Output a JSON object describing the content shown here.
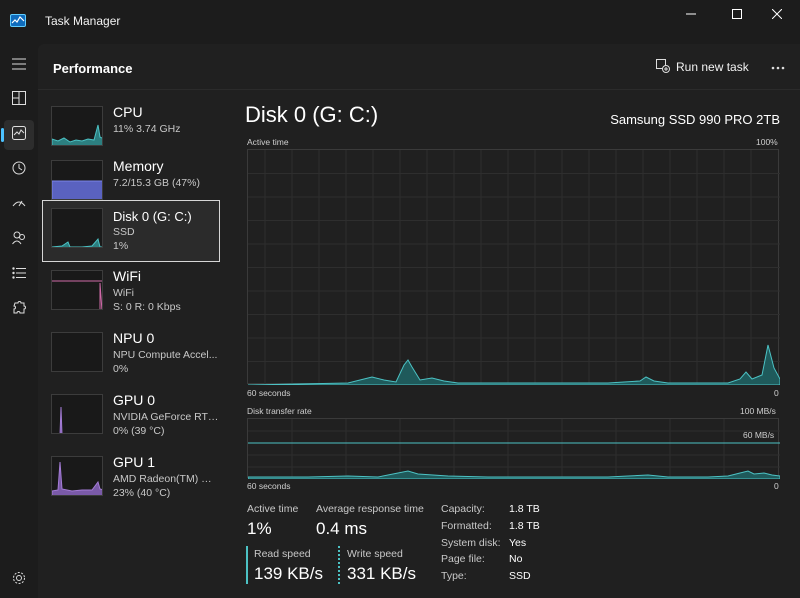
{
  "window": {
    "title": "Task Manager",
    "icon": "task-manager-icon",
    "controls": [
      "minimize-icon",
      "maximize-icon",
      "close-icon"
    ]
  },
  "rail": {
    "items": [
      {
        "name": "hamburger-menu-icon"
      },
      {
        "name": "processes-icon"
      },
      {
        "name": "performance-icon",
        "active": true
      },
      {
        "name": "app-history-icon"
      },
      {
        "name": "startup-apps-icon"
      },
      {
        "name": "users-icon"
      },
      {
        "name": "details-icon"
      },
      {
        "name": "services-icon"
      },
      {
        "name": "settings-icon"
      }
    ]
  },
  "header": {
    "title": "Performance",
    "run_new_task": "Run new task",
    "more": "more-options-icon"
  },
  "devices": [
    {
      "name": "CPU",
      "line1": "11%  3.74 GHz",
      "line2": "",
      "color": "#4cc2c4"
    },
    {
      "name": "Memory",
      "line1": "7.2/15.3 GB (47%)",
      "line2": "",
      "color": "#7b84e6"
    },
    {
      "name": "Disk 0 (G: C:)",
      "line1": "SSD",
      "line2": "1%",
      "color": "#4cc2c4",
      "selected": true
    },
    {
      "name": "WiFi",
      "line1": "WiFi",
      "line2": "S: 0  R: 0 Kbps",
      "color": "#d06aa8"
    },
    {
      "name": "NPU 0",
      "line1": "NPU Compute Accel...",
      "line2": "0%",
      "color": "#4cc2c4"
    },
    {
      "name": "GPU 0",
      "line1": "NVIDIA GeForce RTX...",
      "line2": "0%  (39 °C)",
      "color": "#a47cd6"
    },
    {
      "name": "GPU 1",
      "line1": "AMD Radeon(TM) Gr...",
      "line2": "23%  (40 °C)",
      "color": "#a47cd6"
    }
  ],
  "detail": {
    "title": "Disk 0 (G: C:)",
    "model": "Samsung SSD 990 PRO 2TB",
    "active_chart": {
      "label": "Active time",
      "max_label": "100%",
      "x_left": "60 seconds",
      "x_right": "0"
    },
    "transfer_chart": {
      "label": "Disk transfer rate",
      "max_label": "100 MB/s",
      "mid_label": "60 MB/s",
      "x_left": "60 seconds",
      "x_right": "0"
    },
    "stats": {
      "active_time_label": "Active time",
      "active_time_value": "1%",
      "avg_response_label": "Average response time",
      "avg_response_value": "0.4 ms",
      "read_label": "Read speed",
      "read_value": "139 KB/s",
      "write_label": "Write speed",
      "write_value": "331 KB/s"
    },
    "properties": [
      {
        "key": "Capacity:",
        "value": "1.8 TB"
      },
      {
        "key": "Formatted:",
        "value": "1.8 TB"
      },
      {
        "key": "System disk:",
        "value": "Yes"
      },
      {
        "key": "Page file:",
        "value": "No"
      },
      {
        "key": "Type:",
        "value": "SSD"
      }
    ],
    "accent_color": "#4cc2c4"
  }
}
